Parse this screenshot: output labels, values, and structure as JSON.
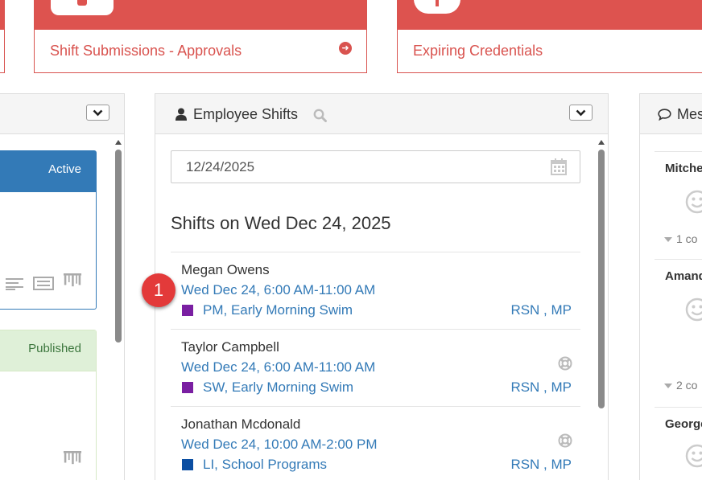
{
  "tiles": {
    "approvals_label": "Shift Submissions - Approvals",
    "credentials_label": "Expiring Credentials"
  },
  "left_panel": {
    "active_label": "Active",
    "published_label": "Published"
  },
  "employee_shifts": {
    "title": "Employee Shifts",
    "date_value": "12/24/2025",
    "heading": "Shifts on Wed Dec 24, 2025",
    "shifts": [
      {
        "name": "Megan Owens",
        "time": "Wed Dec 24, 6:00 AM-11:00 AM",
        "position": "PM, Early Morning Swim",
        "tags": "RSN , MP",
        "color": "#7a1fa2"
      },
      {
        "name": "Taylor Campbell",
        "time": "Wed Dec 24, 6:00 AM-11:00 AM",
        "position": "SW, Early Morning Swim",
        "tags": "RSN , MP",
        "color": "#7a1fa2"
      },
      {
        "name": "Jonathan Mcdonald",
        "time": "Wed Dec 24, 10:00 AM-2:00 PM",
        "position": "LI, School Programs",
        "tags": "RSN , MP",
        "color": "#0b4ea2"
      }
    ]
  },
  "step_badge": "1",
  "messages": {
    "title": "Mes",
    "items": [
      {
        "name": "Mitche",
        "count": "1 co"
      },
      {
        "name": "Amand",
        "count": "2 co"
      },
      {
        "name": "George"
      }
    ]
  },
  "colors": {
    "danger": "#d9534f",
    "primary": "#337ab7",
    "success_bg": "#dff0d8"
  }
}
